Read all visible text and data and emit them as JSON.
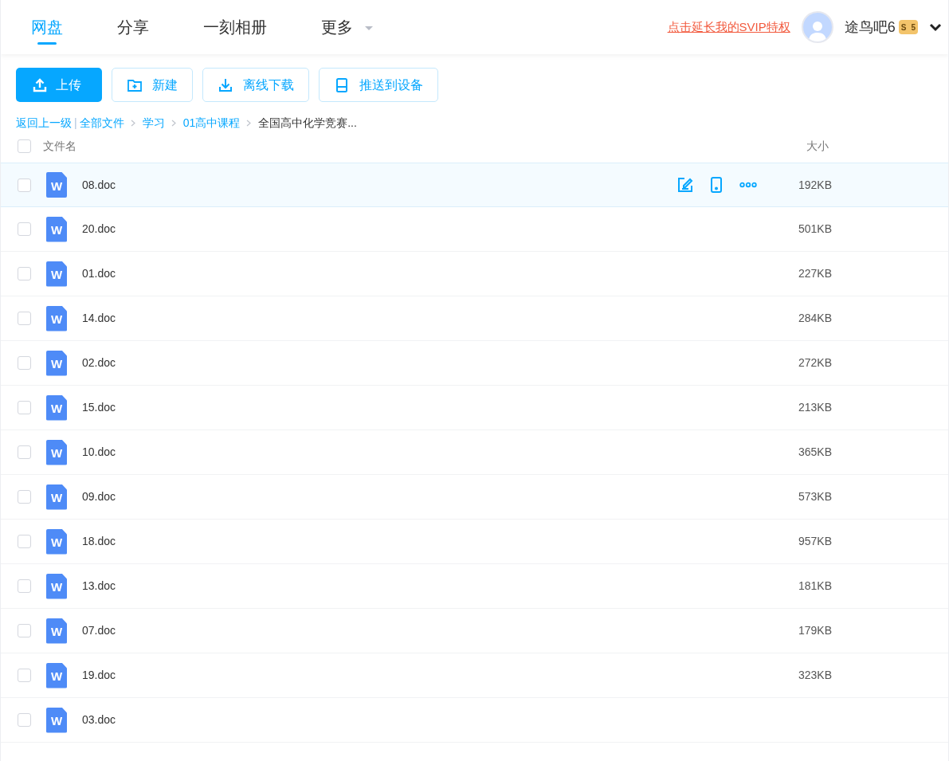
{
  "nav": {
    "tabs": [
      {
        "label": "网盘",
        "selected": true,
        "dropdown": false
      },
      {
        "label": "分享",
        "selected": false,
        "dropdown": false
      },
      {
        "label": "一刻相册",
        "selected": false,
        "dropdown": false
      },
      {
        "label": "更多",
        "selected": false,
        "dropdown": true
      }
    ],
    "promo_link": "点击延长我的SVIP特权",
    "user": {
      "name": "途鸟吧6",
      "badge_letter": "S",
      "badge_level": "5"
    }
  },
  "toolbar": {
    "buttons": [
      {
        "label": "上传",
        "kind": "upload",
        "primary": true
      },
      {
        "label": "新建",
        "kind": "new-folder",
        "primary": false
      },
      {
        "label": "离线下载",
        "kind": "download",
        "primary": false
      },
      {
        "label": "推送到设备",
        "kind": "push",
        "primary": false
      }
    ]
  },
  "breadcrumb": {
    "back": "返回上一级",
    "separator": "|",
    "items": [
      "全部文件",
      "学习",
      "01高中课程"
    ],
    "current": "全国高中化学竞赛..."
  },
  "table": {
    "columns": [
      "文件名",
      "大小"
    ],
    "checked_all": false,
    "rows": [
      {
        "name": "08.doc",
        "icon_letter": "W",
        "size": "192KB",
        "selected": true,
        "checked": false
      },
      {
        "name": "20.doc",
        "icon_letter": "W",
        "size": "501KB",
        "selected": false,
        "checked": false
      },
      {
        "name": "01.doc",
        "icon_letter": "W",
        "size": "227KB",
        "selected": false,
        "checked": false
      },
      {
        "name": "14.doc",
        "icon_letter": "W",
        "size": "284KB",
        "selected": false,
        "checked": false
      },
      {
        "name": "02.doc",
        "icon_letter": "W",
        "size": "272KB",
        "selected": false,
        "checked": false
      },
      {
        "name": "15.doc",
        "icon_letter": "W",
        "size": "213KB",
        "selected": false,
        "checked": false
      },
      {
        "name": "10.doc",
        "icon_letter": "W",
        "size": "365KB",
        "selected": false,
        "checked": false
      },
      {
        "name": "09.doc",
        "icon_letter": "W",
        "size": "573KB",
        "selected": false,
        "checked": false
      },
      {
        "name": "18.doc",
        "icon_letter": "W",
        "size": "957KB",
        "selected": false,
        "checked": false
      },
      {
        "name": "13.doc",
        "icon_letter": "W",
        "size": "181KB",
        "selected": false,
        "checked": false
      },
      {
        "name": "07.doc",
        "icon_letter": "W",
        "size": "179KB",
        "selected": false,
        "checked": false
      },
      {
        "name": "19.doc",
        "icon_letter": "W",
        "size": "323KB",
        "selected": false,
        "checked": false
      },
      {
        "name": "03.doc",
        "icon_letter": "W",
        "selected": false,
        "checked": false
      }
    ]
  }
}
